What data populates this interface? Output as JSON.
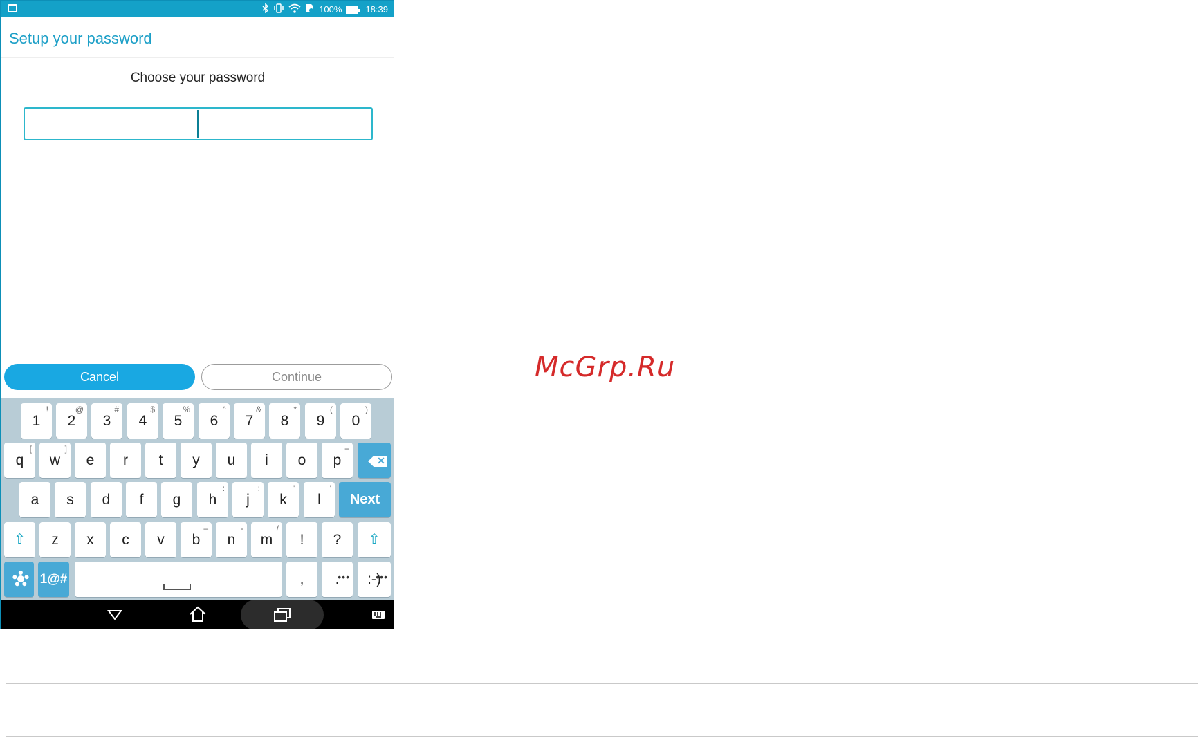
{
  "status_bar": {
    "battery_percent": "100%",
    "time": "18:39",
    "icons": [
      "gallery-icon",
      "bluetooth-icon",
      "vibrate-icon",
      "wifi-icon",
      "sim-icon",
      "battery-icon"
    ]
  },
  "screen": {
    "title": "Setup your password",
    "prompt": "Choose your password",
    "password_value": "",
    "cancel_label": "Cancel",
    "continue_label": "Continue"
  },
  "keyboard": {
    "row1": [
      {
        "label": "1",
        "sub": "!"
      },
      {
        "label": "2",
        "sub": "@"
      },
      {
        "label": "3",
        "sub": "#"
      },
      {
        "label": "4",
        "sub": "$"
      },
      {
        "label": "5",
        "sub": "%"
      },
      {
        "label": "6",
        "sub": "^"
      },
      {
        "label": "7",
        "sub": "&"
      },
      {
        "label": "8",
        "sub": "*"
      },
      {
        "label": "9",
        "sub": "("
      },
      {
        "label": "0",
        "sub": ")"
      }
    ],
    "row2": [
      {
        "label": "q",
        "sub": "["
      },
      {
        "label": "w",
        "sub": "]"
      },
      {
        "label": "e",
        "sub": ""
      },
      {
        "label": "r",
        "sub": ""
      },
      {
        "label": "t",
        "sub": ""
      },
      {
        "label": "y",
        "sub": ""
      },
      {
        "label": "u",
        "sub": ""
      },
      {
        "label": "i",
        "sub": ""
      },
      {
        "label": "o",
        "sub": ""
      },
      {
        "label": "p",
        "sub": "+"
      }
    ],
    "row3": [
      {
        "label": "a",
        "sub": ""
      },
      {
        "label": "s",
        "sub": ""
      },
      {
        "label": "d",
        "sub": ""
      },
      {
        "label": "f",
        "sub": ""
      },
      {
        "label": "g",
        "sub": ""
      },
      {
        "label": "h",
        "sub": ":"
      },
      {
        "label": "j",
        "sub": ";"
      },
      {
        "label": "k",
        "sub": "\""
      },
      {
        "label": "l",
        "sub": "'"
      }
    ],
    "row4": [
      {
        "label": "z",
        "sub": ""
      },
      {
        "label": "x",
        "sub": ""
      },
      {
        "label": "c",
        "sub": ""
      },
      {
        "label": "v",
        "sub": ""
      },
      {
        "label": "b",
        "sub": "–"
      },
      {
        "label": "n",
        "sub": "-"
      },
      {
        "label": "m",
        "sub": "/"
      },
      {
        "label": "!",
        "sub": ""
      },
      {
        "label": "?",
        "sub": ""
      }
    ],
    "next_label": "Next",
    "symbols_label": "1@#",
    "comma_label": ",",
    "period_label": ".",
    "smiley_label": ":-)",
    "shift_glyph": "⇧",
    "more_glyph": "•••"
  },
  "watermark": "McGrp.Ru",
  "colors": {
    "accent": "#1c9fc7",
    "cancel_button": "#19a8e2",
    "keyboard_bg": "#b8ccd6",
    "key_blue": "#48a9d6",
    "watermark": "#d52a2a"
  }
}
